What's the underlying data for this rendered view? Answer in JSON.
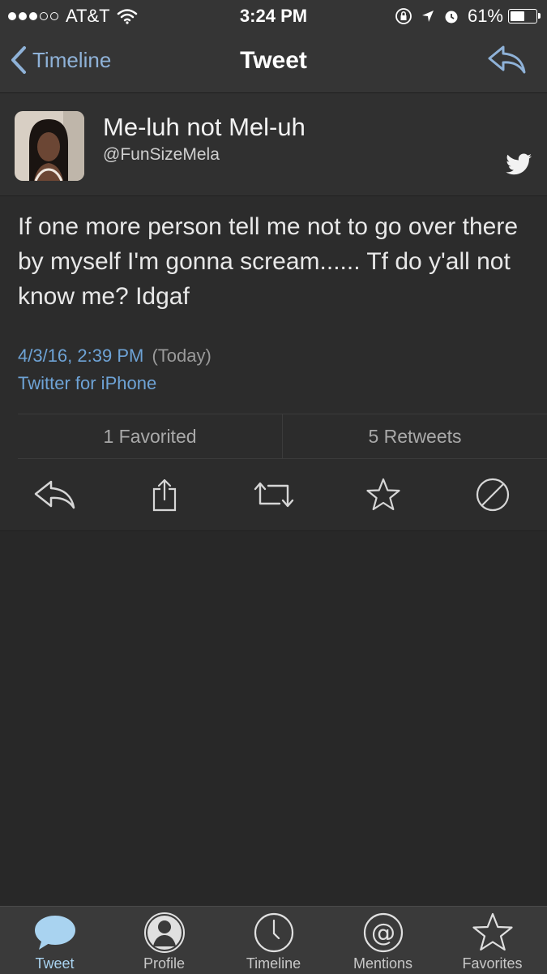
{
  "status_bar": {
    "carrier": "AT&T",
    "time": "3:24 PM",
    "battery_percent": "61%",
    "battery_level": 0.61,
    "signal_dots_filled": 3,
    "signal_dots_total": 5
  },
  "nav": {
    "back_label": "Timeline",
    "title": "Tweet",
    "reply_icon": "reply-arrow-icon"
  },
  "tweet": {
    "user_name": "Me-luh not Mel-uh",
    "handle": "@FunSizeMela",
    "text": "If one more person tell me not to go over there by myself I'm gonna scream...... Tf do y'all not know me? Idgaf",
    "date": "4/3/16, 2:39 PM",
    "date_relative": "(Today)",
    "source": "Twitter for iPhone"
  },
  "stats": {
    "favorites": "1 Favorited",
    "retweets": "5 Retweets"
  },
  "actions": [
    "reply-icon",
    "share-icon",
    "retweet-icon",
    "favorite-star-icon",
    "block-icon"
  ],
  "tabs": [
    {
      "label": "Tweet",
      "icon": "speech-bubble-icon",
      "active": true
    },
    {
      "label": "Profile",
      "icon": "person-icon",
      "active": false
    },
    {
      "label": "Timeline",
      "icon": "clock-icon",
      "active": false
    },
    {
      "label": "Mentions",
      "icon": "at-sign-icon",
      "active": false
    },
    {
      "label": "Favorites",
      "icon": "star-icon",
      "active": false
    }
  ],
  "colors": {
    "link": "#6ea3d6",
    "nav_link": "#8fb2d8",
    "background": "#282828",
    "active_tab": "#a9d3f0"
  }
}
